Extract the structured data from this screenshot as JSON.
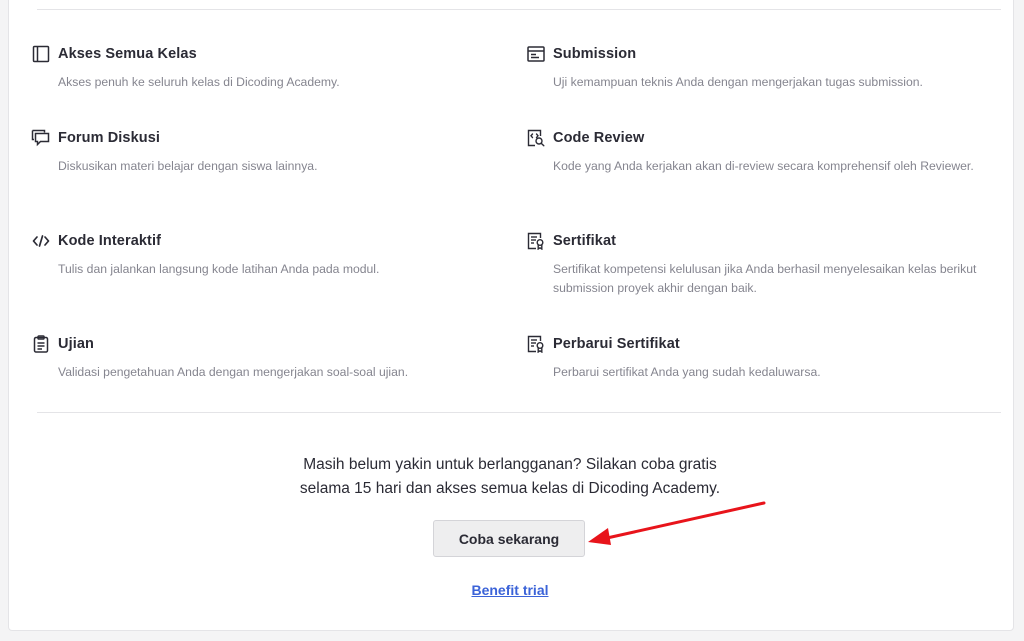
{
  "features": {
    "left": [
      {
        "icon": "book-icon",
        "title": "Akses Semua Kelas",
        "desc": "Akses penuh ke seluruh kelas di Dicoding Academy."
      },
      {
        "icon": "chat-icon",
        "title": "Forum Diskusi",
        "desc": "Diskusikan materi belajar dengan siswa lainnya."
      },
      {
        "icon": "code-icon",
        "title": "Kode Interaktif",
        "desc": "Tulis dan jalankan langsung kode latihan Anda pada modul."
      },
      {
        "icon": "clipboard-icon",
        "title": "Ujian",
        "desc": "Validasi pengetahuan Anda dengan mengerjakan soal-soal ujian."
      }
    ],
    "right": [
      {
        "icon": "window-icon",
        "title": "Submission",
        "desc": "Uji kemampuan teknis Anda dengan mengerjakan tugas submission."
      },
      {
        "icon": "code-review-icon",
        "title": "Code Review",
        "desc": "Kode yang Anda kerjakan akan di-review secara komprehensif oleh Reviewer."
      },
      {
        "icon": "certificate-icon",
        "title": "Sertifikat",
        "desc": "Sertifikat kompetensi kelulusan jika Anda berhasil menyelesaikan kelas berikut submission proyek akhir dengan baik."
      },
      {
        "icon": "certificate-icon",
        "title": "Perbarui Sertifikat",
        "desc": "Perbarui sertifikat Anda yang sudah kedaluwarsa."
      }
    ]
  },
  "cta": {
    "line1": "Masih belum yakin untuk berlangganan? Silakan coba gratis",
    "line2": "selama 15 hari dan akses semua kelas di Dicoding Academy.",
    "button_label": "Coba sekarang",
    "link_label": "Benefit trial"
  },
  "colors": {
    "annotation_arrow": "#e8141b",
    "link": "#3b63d8"
  }
}
